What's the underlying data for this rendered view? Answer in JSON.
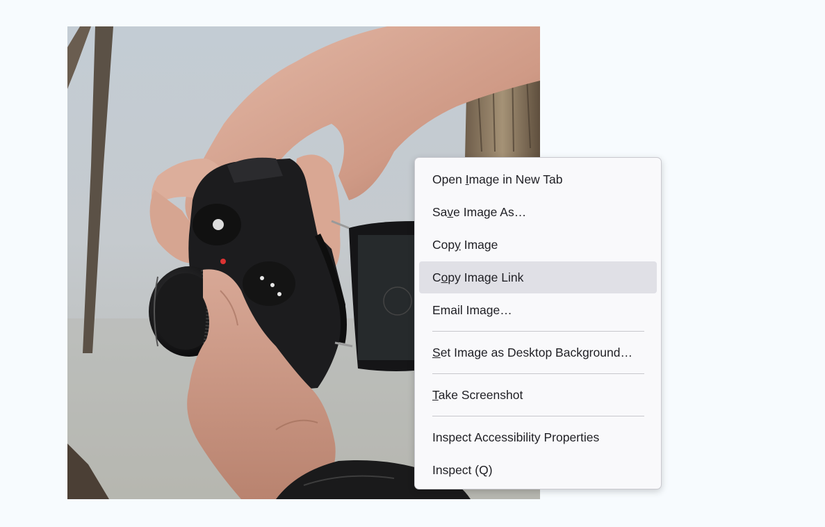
{
  "photo": {
    "subject": "hands-holding-mirrorless-camera-with-flip-screen"
  },
  "context_menu": {
    "items": [
      {
        "label": "Open Image in New Tab",
        "accesskey_index": 5
      },
      {
        "label": "Save Image As…",
        "accesskey_index": 2
      },
      {
        "label": "Copy Image",
        "accesskey_index": 3
      },
      {
        "label": "Copy Image Link",
        "accesskey_index": 1,
        "hovered": true
      },
      {
        "label": "Email Image…",
        "accesskey_index": -1
      },
      {
        "label": "Set Image as Desktop Background…",
        "accesskey_index": 0
      },
      {
        "label": "Take Screenshot",
        "accesskey_index": 0
      },
      {
        "label": "Inspect Accessibility Properties",
        "accesskey_index": -1
      },
      {
        "label": "Inspect (Q)",
        "accesskey_index": -1
      }
    ]
  },
  "colors": {
    "page_bg": "#f7fbfe",
    "menu_bg": "#f9f9fb",
    "menu_hover": "#e0e0e6",
    "menu_text": "#1f1f24"
  }
}
